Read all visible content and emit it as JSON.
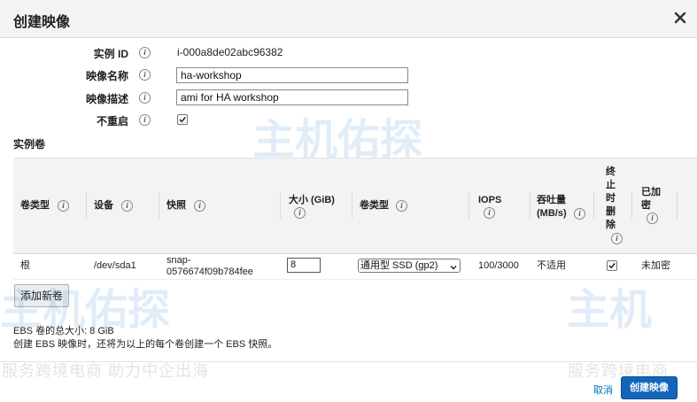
{
  "dialog": {
    "title": "创建映像",
    "close_icon": "close-icon"
  },
  "form": {
    "instance_id_label": "实例 ID",
    "instance_id_value": "i-000a8de02abc96382",
    "image_name_label": "映像名称",
    "image_name_value": "ha-workshop",
    "image_desc_label": "映像描述",
    "image_desc_value": "ami for HA workshop",
    "no_reboot_label": "不重启",
    "no_reboot_checked": true,
    "info_glyph": "i"
  },
  "volumes": {
    "section_title": "实例卷",
    "columns": {
      "volume_type": "卷类型",
      "device": "设备",
      "snapshot": "快照",
      "size": "大小 (GiB)",
      "ebs_type": "卷类型",
      "iops": "IOPS",
      "throughput_line1": "吞吐量",
      "throughput_line2": "(MB/s)",
      "delete_on_term": [
        "终",
        "止",
        "时",
        "删",
        "除"
      ],
      "encrypted_line1": "已加",
      "encrypted_line2": "密"
    },
    "rows": [
      {
        "volume_type": "根",
        "device": "/dev/sda1",
        "snapshot_line1": "snap-",
        "snapshot_line2": "0576674f09b784fee",
        "size": "8",
        "ebs_type": "通用型 SSD (gp2)",
        "iops": "100/3000",
        "throughput": "不适用",
        "delete_on_term": true,
        "encrypted": "未加密"
      }
    ],
    "add_button": "添加新卷"
  },
  "summary": {
    "total_size": "EBS 卷的总大小: 8 GiB",
    "note": "创建 EBS 映像时，还将为以上的每个卷创建一个 EBS 快照。"
  },
  "footer": {
    "cancel": "取消",
    "create": "创建映像"
  },
  "watermark": {
    "brand": "主机佑探",
    "slogan": "服务跨境电商 助力中企出海",
    "brand_short": "主机",
    "slogan_short": "服务跨境电商"
  },
  "colors": {
    "primary": "#1166bb",
    "link": "#0073bb",
    "header_bg": "#f2f3f3"
  }
}
